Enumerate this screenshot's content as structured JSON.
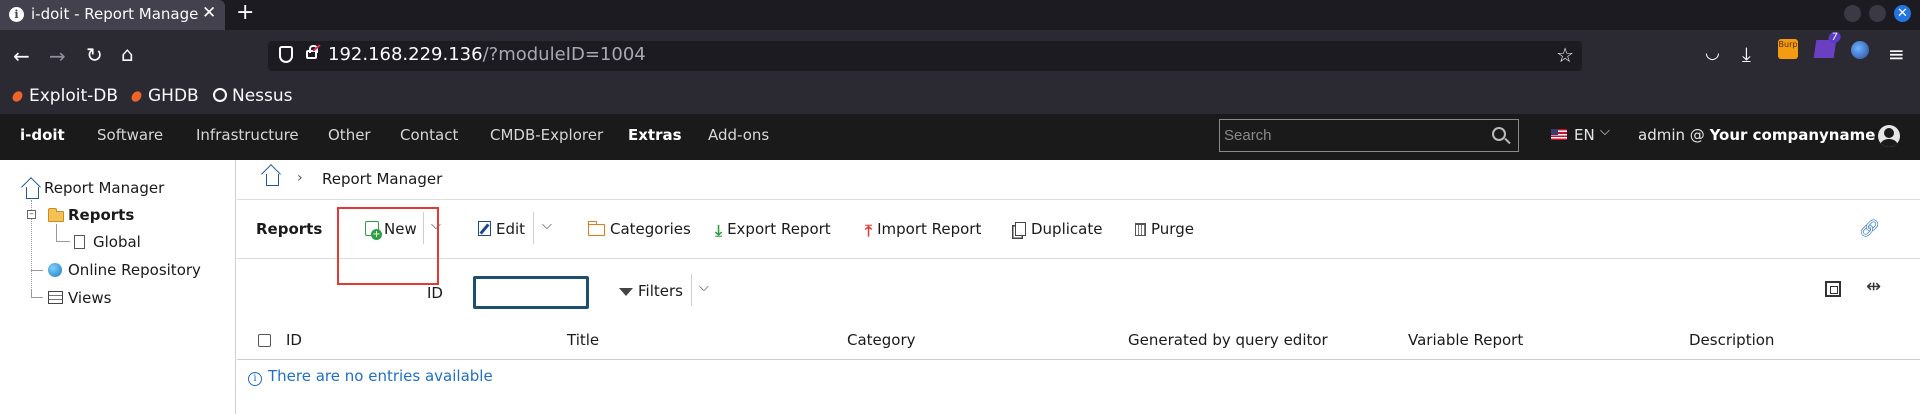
{
  "browser": {
    "tab_title": "i-doit - Report Manager",
    "new_tab_symbol": "+",
    "url_host": "192.168.229.136",
    "url_path": "/?moduleID=1004",
    "bookmarks": [
      "Exploit-DB",
      "GHDB",
      "Nessus"
    ],
    "extensions": {
      "burp_label": "Burp",
      "badge_count": "7"
    }
  },
  "app": {
    "logo": "i-doit",
    "menu": [
      "Software",
      "Infrastructure",
      "Other",
      "Contact",
      "CMDB-Explorer",
      "Extras",
      "Add-ons"
    ],
    "active_menu": "Extras",
    "search_placeholder": "Search",
    "language": "EN",
    "user_prefix": "admin @",
    "company": "Your companyname"
  },
  "sidebar": {
    "root": "Report Manager",
    "reports": "Reports",
    "global": "Global",
    "online_repository": "Online Repository",
    "views": "Views"
  },
  "breadcrumb": {
    "current": "Report Manager"
  },
  "toolbar": {
    "title": "Reports",
    "new": "New",
    "edit": "Edit",
    "categories": "Categories",
    "export": "Export Report",
    "import": "Import Report",
    "duplicate": "Duplicate",
    "purge": "Purge"
  },
  "filter": {
    "id_label": "ID",
    "id_value": "",
    "filters_label": "Filters"
  },
  "table": {
    "columns": [
      "ID",
      "Title",
      "Category",
      "Generated by query editor",
      "Variable Report",
      "Description"
    ],
    "empty_message": "There are no entries available"
  },
  "colors": {
    "accent_blue": "#1f6fc7",
    "highlight_red": "#e53935",
    "app_bar": "#1a1a1a",
    "browser_bg": "#2b2a33"
  }
}
